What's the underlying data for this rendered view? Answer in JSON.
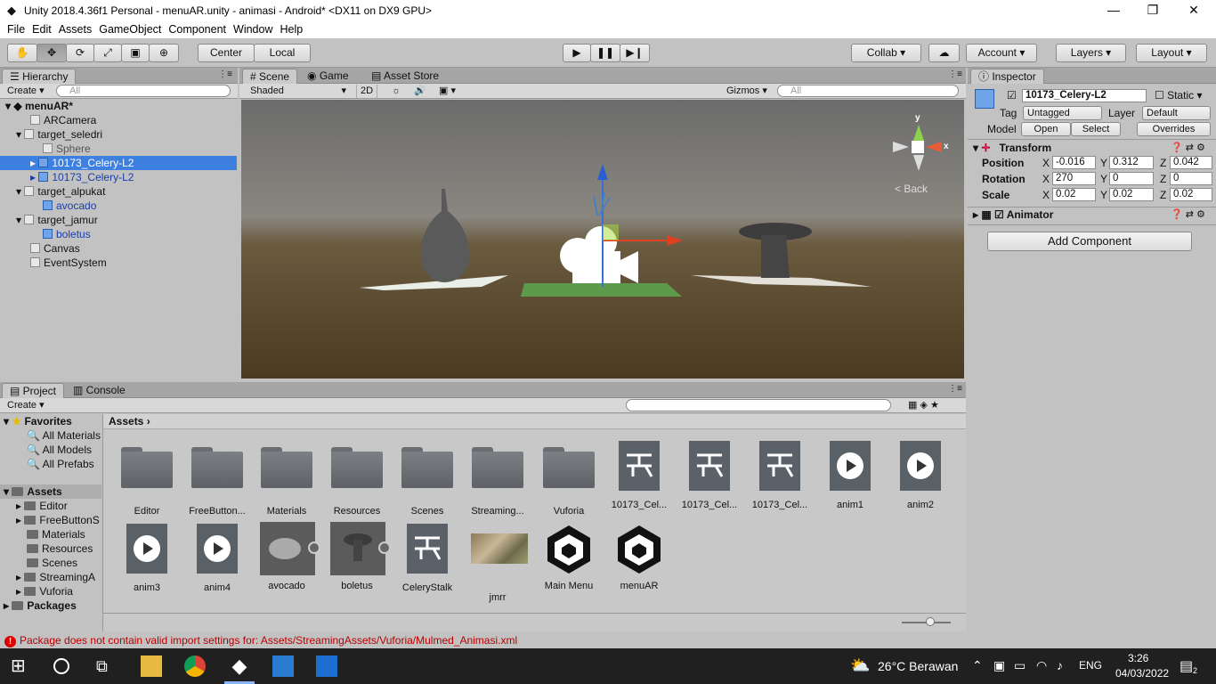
{
  "window": {
    "title": "Unity 2018.4.36f1 Personal - menuAR.unity - animasi - Android* <DX11 on DX9 GPU>",
    "minimize": "—",
    "maximize": "❐",
    "close": "✕"
  },
  "menu": [
    "File",
    "Edit",
    "Assets",
    "GameObject",
    "Component",
    "Window",
    "Help"
  ],
  "toolbar": {
    "pivot": "Center",
    "space": "Local",
    "collab": "Collab",
    "account": "Account",
    "layers": "Layers",
    "layout": "Layout"
  },
  "hierarchy": {
    "tab": "Hierarchy",
    "create": "Create",
    "search_placeholder": "All",
    "scene": "menuAR*",
    "items": [
      {
        "label": "ARCamera"
      },
      {
        "label": "target_seledri"
      },
      {
        "label": "Sphere"
      },
      {
        "label": "10173_Celery-L2"
      },
      {
        "label": "10173_Celery-L2"
      },
      {
        "label": "target_alpukat"
      },
      {
        "label": "avocado"
      },
      {
        "label": "target_jamur"
      },
      {
        "label": "boletus"
      },
      {
        "label": "Canvas"
      },
      {
        "label": "EventSystem"
      }
    ]
  },
  "scene": {
    "tabs": [
      "Scene",
      "Game",
      "Asset Store"
    ],
    "shading": "Shaded",
    "mode2d": "2D",
    "gizmos": "Gizmos",
    "search_placeholder": "All",
    "back_label": "Back",
    "axis_y": "y",
    "axis_x": "x"
  },
  "inspector": {
    "tab": "Inspector",
    "object_name": "10173_Celery-L2",
    "static": "Static",
    "tag_label": "Tag",
    "tag_value": "Untagged",
    "layer_label": "Layer",
    "layer_value": "Default",
    "model_label": "Model",
    "open": "Open",
    "select": "Select",
    "overrides": "Overrides",
    "transform": "Transform",
    "position_label": "Position",
    "rotation_label": "Rotation",
    "scale_label": "Scale",
    "axis_x": "X",
    "axis_y": "Y",
    "axis_z": "Z",
    "position": {
      "x": "-0.016",
      "y": "0.312",
      "z": "0.042"
    },
    "rotation": {
      "x": "270",
      "y": "0",
      "z": "0"
    },
    "scale": {
      "x": "0.02",
      "y": "0.02",
      "z": "0.02"
    },
    "animator": "Animator",
    "add_component": "Add Component"
  },
  "project": {
    "tabs": [
      "Project",
      "Console"
    ],
    "create": "Create",
    "favorites": "Favorites",
    "fav_items": [
      "All Materials",
      "All Models",
      "All Prefabs"
    ],
    "assets_root": "Assets",
    "tree": [
      "Editor",
      "FreeButtonS",
      "Materials",
      "Resources",
      "Scenes",
      "StreamingA",
      "Vuforia"
    ],
    "packages": "Packages",
    "breadcrumb": "Assets",
    "assets": [
      {
        "label": "Editor",
        "kind": "folder"
      },
      {
        "label": "FreeButton...",
        "kind": "folder"
      },
      {
        "label": "Materials",
        "kind": "folder"
      },
      {
        "label": "Resources",
        "kind": "folder"
      },
      {
        "label": "Scenes",
        "kind": "folder"
      },
      {
        "label": "Streaming...",
        "kind": "folder"
      },
      {
        "label": "Vuforia",
        "kind": "folder"
      },
      {
        "label": "10173_Cel...",
        "kind": "controller"
      },
      {
        "label": "10173_Cel...",
        "kind": "controller"
      },
      {
        "label": "10173_Cel...",
        "kind": "controller"
      },
      {
        "label": "anim1",
        "kind": "anim"
      },
      {
        "label": "anim2",
        "kind": "anim"
      },
      {
        "label": "anim3",
        "kind": "anim"
      },
      {
        "label": "anim4",
        "kind": "anim"
      },
      {
        "label": "avocado",
        "kind": "prefab"
      },
      {
        "label": "boletus",
        "kind": "prefab"
      },
      {
        "label": "CeleryStalk",
        "kind": "controller"
      },
      {
        "label": "jmrr",
        "kind": "image"
      },
      {
        "label": "Main Menu",
        "kind": "unity"
      },
      {
        "label": "menuAR",
        "kind": "unity"
      }
    ]
  },
  "status": "Package does not contain valid import settings for: Assets/StreamingAssets/Vuforia/Mulmed_Animasi.xml",
  "taskbar": {
    "weather": "26°C  Berawan",
    "lang": "ENG",
    "time": "3:26",
    "date": "04/03/2022",
    "notif_count": "2"
  },
  "colors": {
    "selection": "#3d80df",
    "error": "#b00000",
    "accent_blue": "#1a3ea8"
  }
}
